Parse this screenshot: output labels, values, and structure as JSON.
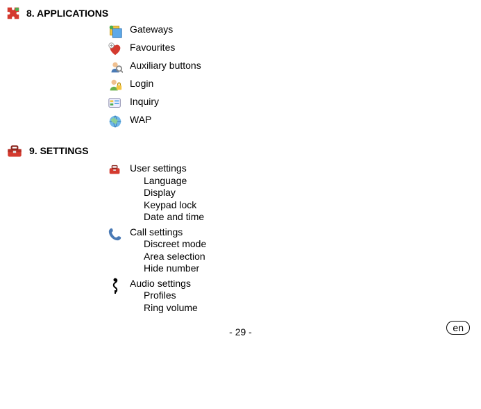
{
  "sections": [
    {
      "title": "8. APPLICATIONS",
      "items": [
        {
          "label": "Gateways",
          "sub": []
        },
        {
          "label": "Favourites",
          "sub": []
        },
        {
          "label": "Auxiliary buttons",
          "sub": []
        },
        {
          "label": "Login",
          "sub": []
        },
        {
          "label": "Inquiry",
          "sub": []
        },
        {
          "label": "WAP",
          "sub": []
        }
      ]
    },
    {
      "title": "9. SETTINGS",
      "items": [
        {
          "label": "User settings",
          "sub": [
            "Language",
            "Display",
            "Keypad lock",
            "Date and time"
          ]
        },
        {
          "label": "Call settings",
          "sub": [
            "Discreet mode",
            "Area selection",
            "Hide number"
          ]
        },
        {
          "label": "Audio settings",
          "sub": [
            "Profiles",
            "Ring volume"
          ]
        }
      ]
    }
  ],
  "page_number": "- 29 -",
  "language_badge": "en"
}
